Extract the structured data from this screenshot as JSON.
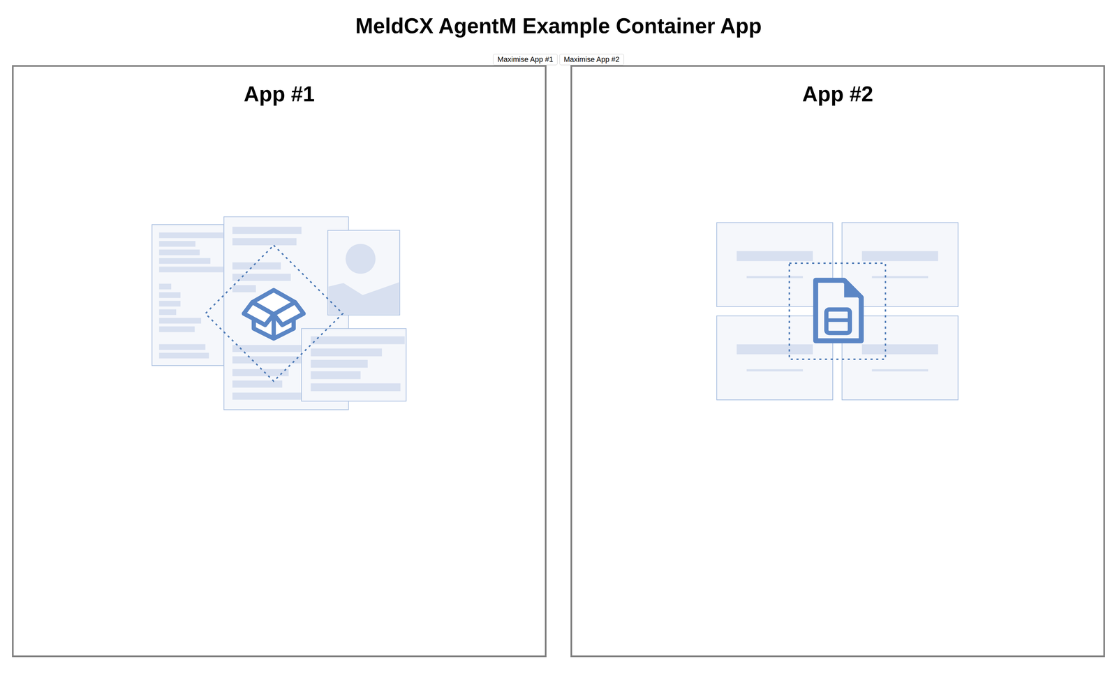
{
  "window": {
    "title": "MeldCX AgentM Example Container App"
  },
  "toolbar": {
    "buttons": [
      {
        "label": "Maximise App #1"
      },
      {
        "label": "Maximise App #2"
      }
    ]
  },
  "apps": [
    {
      "title": "App #1",
      "kind": "package"
    },
    {
      "title": "App #2",
      "kind": "document"
    }
  ]
}
